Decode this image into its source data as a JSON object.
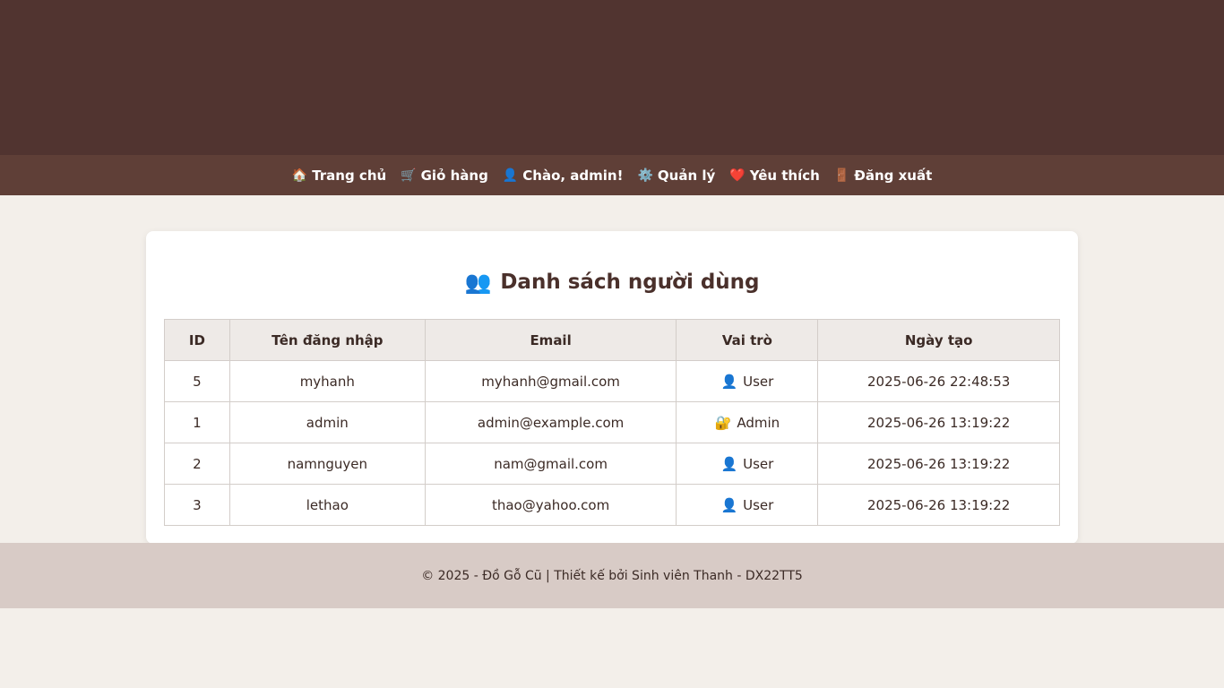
{
  "nav": {
    "items": [
      {
        "icon": "🏠",
        "label": "Trang chủ"
      },
      {
        "icon": "🛒",
        "label": "Giỏ hàng"
      },
      {
        "icon": "👤",
        "label": "Chào, admin!"
      },
      {
        "icon": "⚙️",
        "label": "Quản lý"
      },
      {
        "icon": "❤️",
        "label": "Yêu thích"
      },
      {
        "icon": "🚪",
        "label": "Đăng xuất"
      }
    ]
  },
  "page": {
    "title_icon": "👥",
    "title": "Danh sách người dùng"
  },
  "table": {
    "headers": [
      "ID",
      "Tên đăng nhập",
      "Email",
      "Vai trò",
      "Ngày tạo"
    ],
    "rows": [
      {
        "id": "5",
        "username": "myhanh",
        "email": "myhanh@gmail.com",
        "role_icon": "👤",
        "role": "User",
        "created": "2025-06-26 22:48:53"
      },
      {
        "id": "1",
        "username": "admin",
        "email": "admin@example.com",
        "role_icon": "🔐",
        "role": "Admin",
        "created": "2025-06-26 13:19:22"
      },
      {
        "id": "2",
        "username": "namnguyen",
        "email": "nam@gmail.com",
        "role_icon": "👤",
        "role": "User",
        "created": "2025-06-26 13:19:22"
      },
      {
        "id": "3",
        "username": "lethao",
        "email": "thao@yahoo.com",
        "role_icon": "👤",
        "role": "User",
        "created": "2025-06-26 13:19:22"
      }
    ]
  },
  "footer": {
    "text": "© 2025 - Đồ Gỗ Cũ | Thiết kế bởi Sinh viên Thanh - DX22TT5"
  }
}
